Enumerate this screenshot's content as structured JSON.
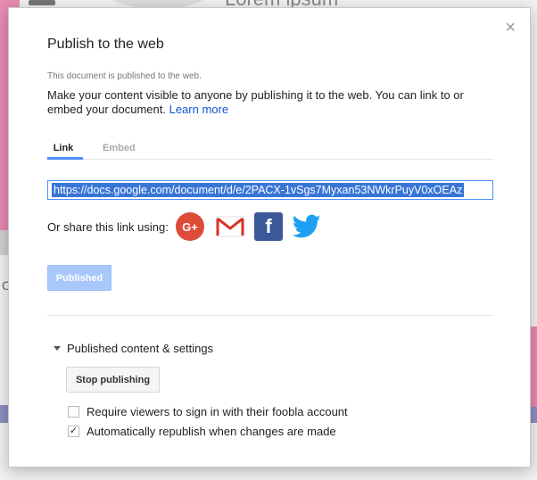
{
  "background": {
    "title_fragment": "Lorem ipsum",
    "letter_fragment": "C"
  },
  "dialog": {
    "title": "Publish to the web",
    "close_glyph": "×",
    "status": "This document is published to the web.",
    "description": "Make your content visible to anyone by publishing it to the web. You can link to or embed your document.",
    "learn_more": "Learn more",
    "tabs": [
      {
        "label": "Link",
        "active": true
      },
      {
        "label": "Embed",
        "active": false
      }
    ],
    "url": "https://docs.google.com/document/d/e/2PACX-1vSgs7Myxan53NWkrPuyV0xOEAz",
    "share_label": "Or share this link using:",
    "share_icons": [
      "google-plus-icon",
      "gmail-icon",
      "facebook-icon",
      "twitter-icon"
    ],
    "gplus_glyph": "G+",
    "fb_glyph": "f",
    "published_button": "Published",
    "section_label": "Published content & settings",
    "stop_button": "Stop publishing",
    "options": [
      {
        "label": "Require viewers to sign in with their foobla account",
        "checked": false
      },
      {
        "label": "Automatically republish when changes are made",
        "checked": true
      }
    ],
    "checkmark": "✓",
    "colors": {
      "accent": "#4d90fe",
      "link": "#1155cc",
      "published_btn": "#a8c7fa",
      "gplus": "#dd4b39",
      "facebook": "#3b5998",
      "twitter": "#1da1f2"
    }
  }
}
